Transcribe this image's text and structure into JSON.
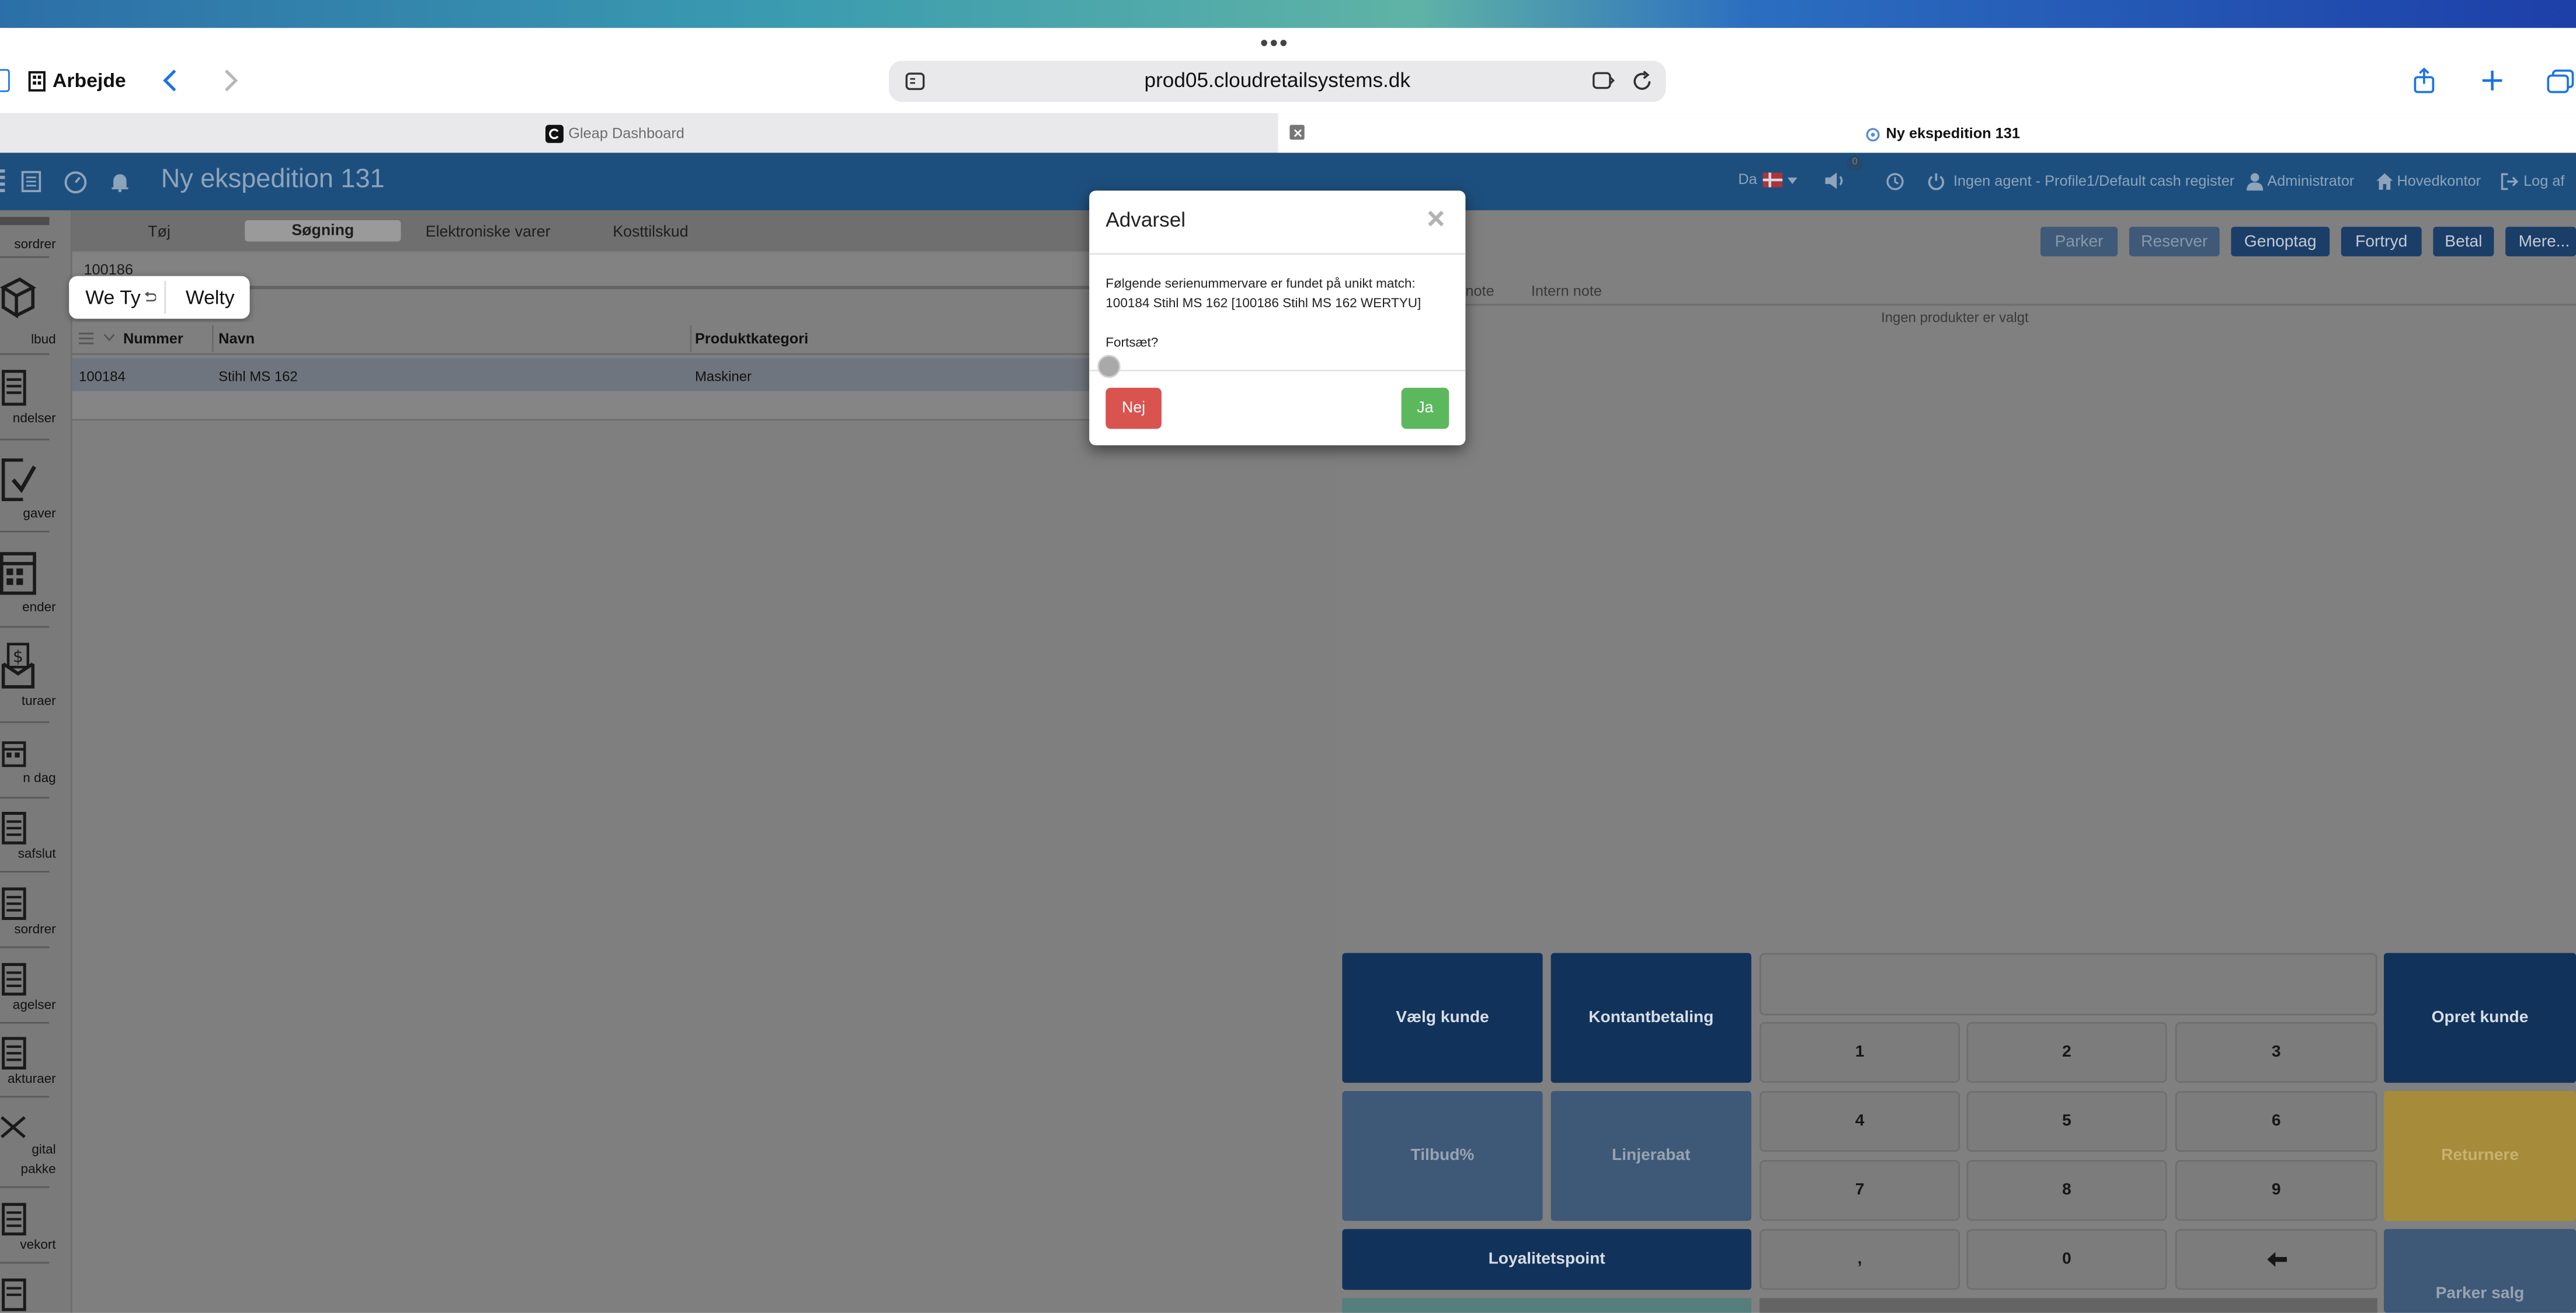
{
  "browser": {
    "window_dots": "•••",
    "sidebar_label": "Arbejde",
    "url": "prod05.cloudretailsystems.dk",
    "tabs": [
      {
        "title": "Gleap Dashboard"
      },
      {
        "title": "Ny ekspedition 131"
      }
    ]
  },
  "app": {
    "title": "Ny ekspedition 131",
    "language": "Da",
    "notification_count": "0",
    "agent_status": "Ingen agent - Profile1/Default cash register",
    "user": "Administrator",
    "location": "Hovedkontor",
    "logout": "Log af"
  },
  "sidebar": {
    "items": [
      {
        "label": "sordrer"
      },
      {
        "label": "lbud"
      },
      {
        "label": "ndelser"
      },
      {
        "label": "gaver"
      },
      {
        "label": "ender"
      },
      {
        "label": "turaer"
      },
      {
        "label": "n dag"
      },
      {
        "label": "safslut"
      },
      {
        "label": "sordrer"
      },
      {
        "label": "agelser"
      },
      {
        "label": "akturaer"
      },
      {
        "label": "gital",
        "label2": "pakke"
      },
      {
        "label": "vekort"
      }
    ]
  },
  "categories": [
    "Tøj",
    "Søgning",
    "Elektroniske varer",
    "Kosttilskud"
  ],
  "search": {
    "value": "100186"
  },
  "autocomplete": {
    "suggestion1": "We Ty",
    "suggestion2": "Welty"
  },
  "product_table": {
    "headers": [
      "Nummer",
      "Navn",
      "Produktkategori"
    ],
    "rows": [
      {
        "nummer": "100184",
        "navn": "Stihl MS 162",
        "kategori": "Maskiner"
      }
    ]
  },
  "actions": [
    "Parker",
    "Reserver",
    "Genoptag",
    "Fortryd",
    "Betal",
    "Mere..."
  ],
  "note_tabs": [
    "note",
    "Intern note"
  ],
  "empty_products": "Ingen produkter er valgt",
  "pos_buttons": {
    "choose_customer": "Vælg kunde",
    "cash_payment": "Kontantbetaling",
    "create_customer": "Opret kunde",
    "offer_pct": "Tilbud%",
    "line_discount": "Linjerabat",
    "return": "Returnere",
    "loyalty": "Loyalitetspoint",
    "park_sale": "Parker salg"
  },
  "keypad": [
    "1",
    "2",
    "3",
    "4",
    "5",
    "6",
    "7",
    "8",
    "9",
    ",",
    "0"
  ],
  "modal": {
    "title": "Advarsel",
    "message_line1": "Følgende serienummervare er fundet på unikt match:",
    "message_line2": "100184 Stihl MS 162 [100186 Stihl MS 162 WERTYU]",
    "question": "Fortsæt?",
    "no": "Nej",
    "yes": "Ja"
  },
  "colors": {
    "appbar": "#1d4f7e",
    "pos_dark": "#11325a",
    "danger": "#d9534f",
    "success": "#5cb85c",
    "return_yellow": "#a58b3a"
  }
}
